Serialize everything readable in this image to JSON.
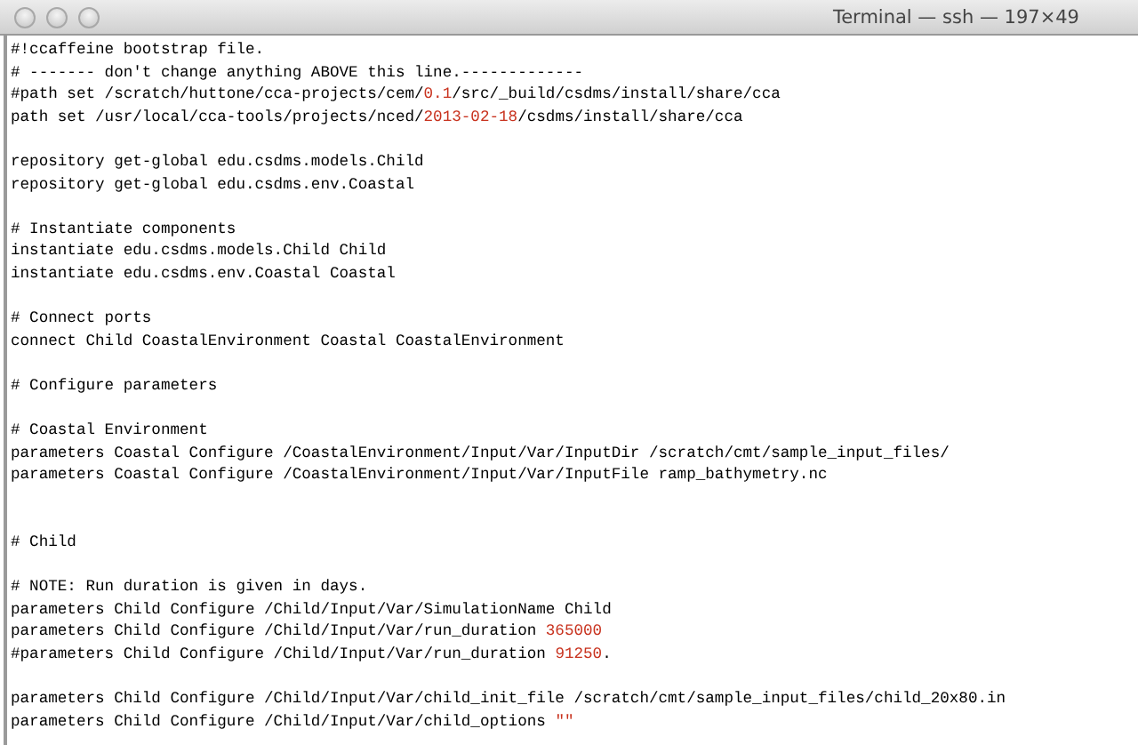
{
  "window": {
    "title": "Terminal — ssh — 197×49"
  },
  "lines": [
    {
      "kind": "code",
      "segments": [
        {
          "kind": "plain",
          "text": "#!ccaffeine bootstrap file."
        }
      ]
    },
    {
      "kind": "code",
      "segments": [
        {
          "kind": "plain",
          "text": "# ------- don't change anything ABOVE this line.-------------"
        }
      ]
    },
    {
      "kind": "code",
      "segments": [
        {
          "kind": "plain",
          "text": "#path set /scratch/huttone/cca-projects/cem/"
        },
        {
          "kind": "literal",
          "text": "0.1"
        },
        {
          "kind": "plain",
          "text": "/src/_build/csdms/install/share/cca"
        }
      ]
    },
    {
      "kind": "code",
      "segments": [
        {
          "kind": "plain",
          "text": "path set /usr/local/cca-tools/projects/nced/"
        },
        {
          "kind": "literal",
          "text": "2013-02-18"
        },
        {
          "kind": "plain",
          "text": "/csdms/install/share/cca"
        }
      ]
    },
    {
      "kind": "blank"
    },
    {
      "kind": "code",
      "segments": [
        {
          "kind": "plain",
          "text": "repository get-global edu.csdms.models.Child"
        }
      ]
    },
    {
      "kind": "code",
      "segments": [
        {
          "kind": "plain",
          "text": "repository get-global edu.csdms.env.Coastal"
        }
      ]
    },
    {
      "kind": "blank"
    },
    {
      "kind": "code",
      "segments": [
        {
          "kind": "plain",
          "text": "# Instantiate components"
        }
      ]
    },
    {
      "kind": "code",
      "segments": [
        {
          "kind": "plain",
          "text": "instantiate edu.csdms.models.Child Child"
        }
      ]
    },
    {
      "kind": "code",
      "segments": [
        {
          "kind": "plain",
          "text": "instantiate edu.csdms.env.Coastal Coastal"
        }
      ]
    },
    {
      "kind": "blank"
    },
    {
      "kind": "code",
      "segments": [
        {
          "kind": "plain",
          "text": "# Connect ports"
        }
      ]
    },
    {
      "kind": "code",
      "segments": [
        {
          "kind": "plain",
          "text": "connect Child CoastalEnvironment Coastal CoastalEnvironment"
        }
      ]
    },
    {
      "kind": "blank"
    },
    {
      "kind": "code",
      "segments": [
        {
          "kind": "plain",
          "text": "# Configure parameters"
        }
      ]
    },
    {
      "kind": "blank"
    },
    {
      "kind": "code",
      "segments": [
        {
          "kind": "plain",
          "text": "# Coastal Environment"
        }
      ]
    },
    {
      "kind": "code",
      "segments": [
        {
          "kind": "plain",
          "text": "parameters Coastal Configure /CoastalEnvironment/Input/Var/InputDir /scratch/cmt/sample_input_files/"
        }
      ]
    },
    {
      "kind": "code",
      "segments": [
        {
          "kind": "plain",
          "text": "parameters Coastal Configure /CoastalEnvironment/Input/Var/InputFile ramp_bathymetry.nc"
        }
      ]
    },
    {
      "kind": "blank"
    },
    {
      "kind": "blank"
    },
    {
      "kind": "code",
      "segments": [
        {
          "kind": "plain",
          "text": "# Child"
        }
      ]
    },
    {
      "kind": "blank"
    },
    {
      "kind": "code",
      "segments": [
        {
          "kind": "plain",
          "text": "# NOTE: Run duration is given in days."
        }
      ]
    },
    {
      "kind": "code",
      "segments": [
        {
          "kind": "plain",
          "text": "parameters Child Configure /Child/Input/Var/SimulationName Child"
        }
      ]
    },
    {
      "kind": "code",
      "segments": [
        {
          "kind": "plain",
          "text": "parameters Child Configure /Child/Input/Var/run_duration "
        },
        {
          "kind": "literal",
          "text": "365000"
        }
      ]
    },
    {
      "kind": "code",
      "segments": [
        {
          "kind": "plain",
          "text": "#parameters Child Configure /Child/Input/Var/run_duration "
        },
        {
          "kind": "literal",
          "text": "91250"
        },
        {
          "kind": "plain",
          "text": "."
        }
      ]
    },
    {
      "kind": "blank"
    },
    {
      "kind": "code",
      "segments": [
        {
          "kind": "plain",
          "text": "parameters Child Configure /Child/Input/Var/child_init_file /scratch/cmt/sample_input_files/child_20x80.in"
        }
      ]
    },
    {
      "kind": "code",
      "segments": [
        {
          "kind": "plain",
          "text": "parameters Child Configure /Child/Input/Var/child_options "
        },
        {
          "kind": "literal",
          "text": "\"\""
        }
      ]
    }
  ]
}
